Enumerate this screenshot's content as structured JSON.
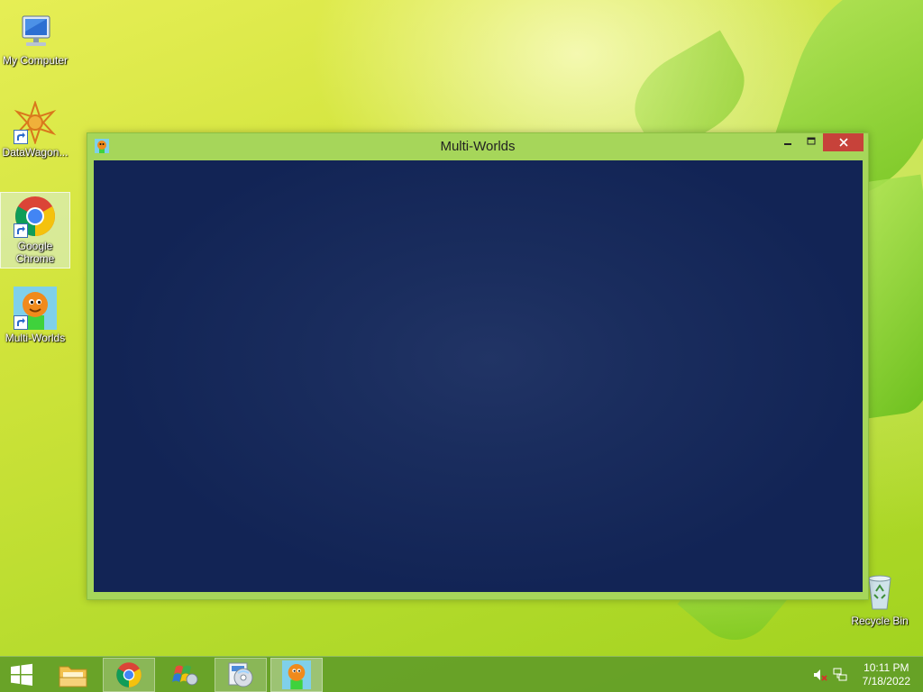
{
  "desktop": {
    "icons": [
      {
        "label": "My Computer",
        "icon": "my-computer-icon"
      },
      {
        "label": "DataWagon...",
        "icon": "datawagon-icon"
      },
      {
        "label": "Google Chrome",
        "line1": "Google",
        "line2": "Chrome",
        "icon": "chrome-icon"
      },
      {
        "label": "Multi-Worlds",
        "icon": "multi-worlds-icon"
      }
    ],
    "recycle_bin": {
      "label": "Recycle Bin",
      "icon": "recycle-bin-icon"
    }
  },
  "window": {
    "title": "Multi-Worlds",
    "buttons": {
      "minimize": "minimize",
      "maximize": "maximize",
      "close": "close"
    },
    "client_color": "#1a2d5e"
  },
  "taskbar": {
    "items": [
      {
        "name": "start",
        "icon": "windows-logo-icon"
      },
      {
        "name": "file-explorer",
        "icon": "folder-icon"
      },
      {
        "name": "google-chrome",
        "icon": "chrome-icon"
      },
      {
        "name": "windows-update",
        "icon": "windows-flag-icon"
      },
      {
        "name": "disc-burner",
        "icon": "disc-icon"
      },
      {
        "name": "multi-worlds",
        "icon": "multi-worlds-icon"
      }
    ],
    "tray": {
      "time": "10:11 PM",
      "date": "7/18/2022",
      "icons": [
        "muted-speaker-icon",
        "network-icon"
      ]
    }
  },
  "colors": {
    "window_frame": "#a6d65a",
    "close_button": "#c7423a",
    "taskbar": "#5f9b28"
  }
}
